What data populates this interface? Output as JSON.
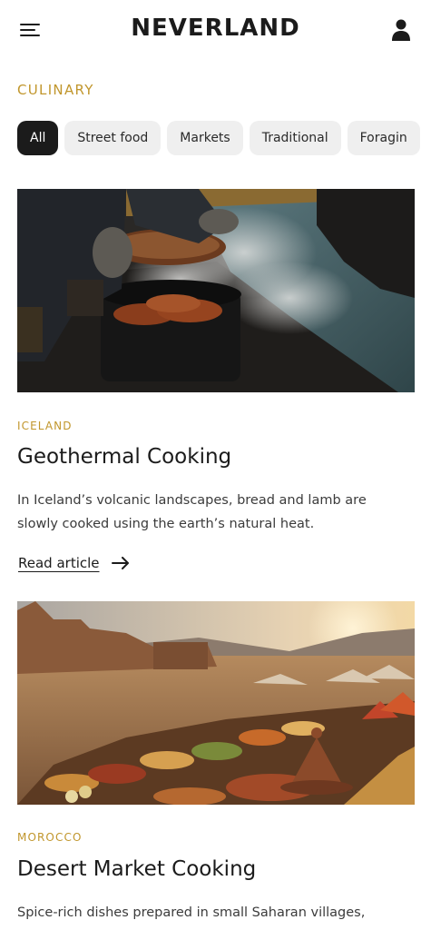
{
  "header": {
    "logo": "NEVERLAND",
    "menu_icon": "hamburger-menu-icon",
    "account_icon": "user-account-icon"
  },
  "section": {
    "label": "CULINARY"
  },
  "filters": {
    "chips": [
      "All",
      "Street food",
      "Markets",
      "Traditional",
      "Foragin"
    ],
    "active": "All"
  },
  "articles": [
    {
      "country": "ICELAND",
      "title": "Geothermal Cooking",
      "description": "In Iceland’s volcanic landscapes, bread and lamb are slowly cooked using the earth’s natural heat.",
      "link_label": "Read article",
      "link_icon": "arrow-right-icon"
    },
    {
      "country": "MOROCCO",
      "title": "Desert Market Cooking",
      "description": "Spice-rich dishes prepared in small Saharan villages,"
    }
  ],
  "colors": {
    "accent": "#c1962c",
    "text": "#1b1b1b",
    "chip_bg": "#efefef",
    "chip_active_bg": "#1b1b1b"
  }
}
